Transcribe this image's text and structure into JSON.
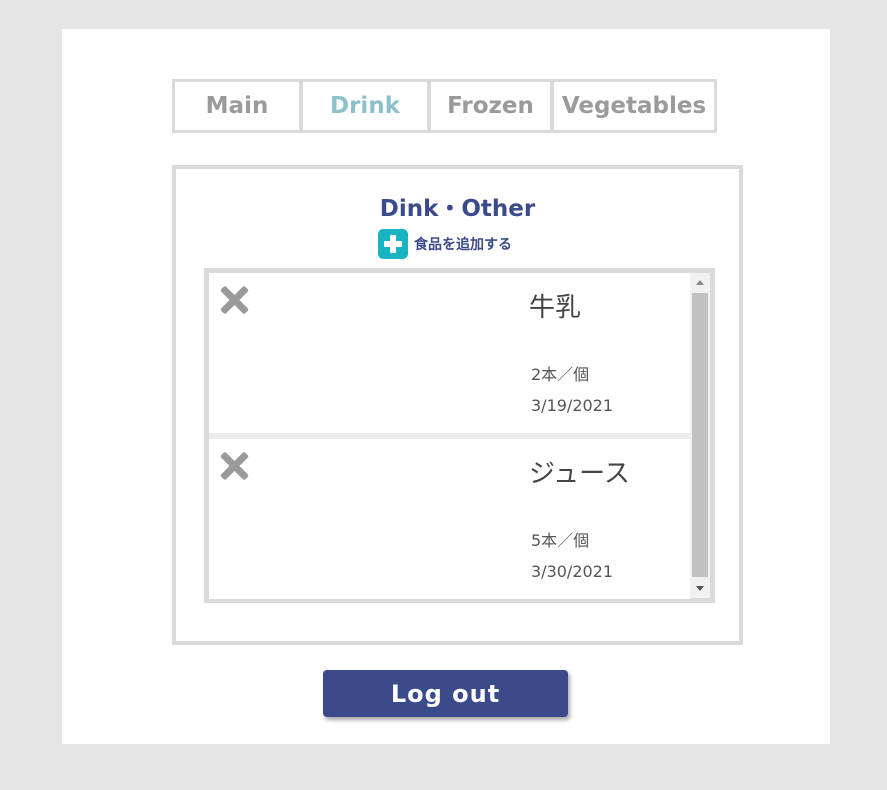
{
  "tabs": [
    {
      "label": "Main",
      "active": false
    },
    {
      "label": "Drink",
      "active": true
    },
    {
      "label": "Frozen",
      "active": false
    },
    {
      "label": "Vegetables",
      "active": false
    }
  ],
  "panel": {
    "title": "Dink・Other",
    "add_label": "食品を追加する",
    "add_icon": "plus-icon"
  },
  "items": [
    {
      "name": "牛乳",
      "quantity": "2本／個",
      "date": "3/19/2021",
      "delete_icon": "close-icon"
    },
    {
      "name": "ジュース",
      "quantity": "5本／個",
      "date": "3/30/2021",
      "delete_icon": "close-icon"
    }
  ],
  "logout_label": "Log out",
  "colors": {
    "background": "#e5e5e5",
    "card": "#ffffff",
    "accent": "#3a4a8a",
    "active_tab": "#8cc1c9",
    "inactive_tab": "#9a9a9a",
    "add_button": "#19b3c3",
    "border": "#dadada"
  }
}
